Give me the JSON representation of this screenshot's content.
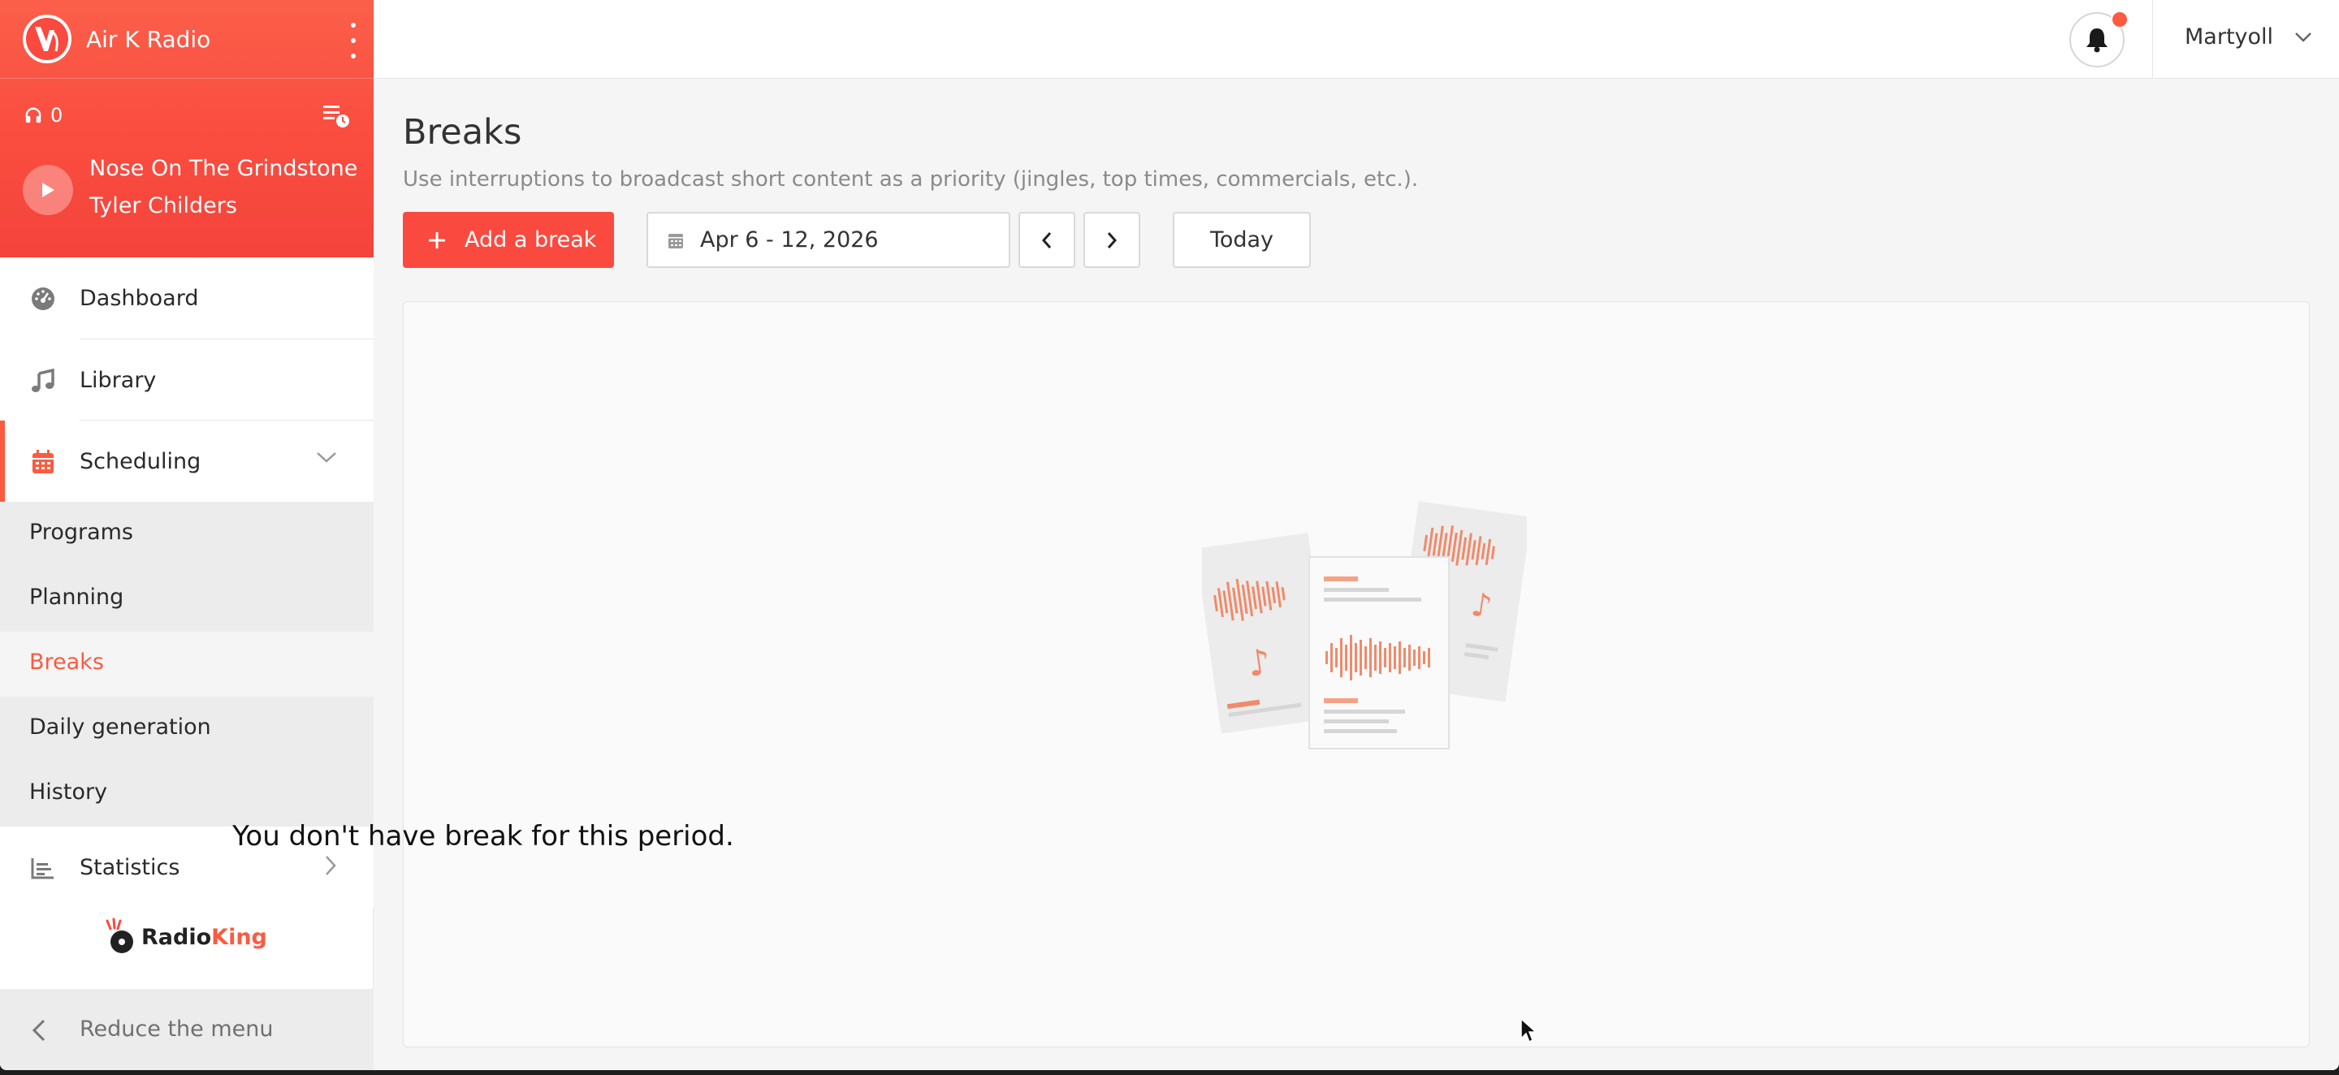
{
  "app": {
    "name": "Air K Radio"
  },
  "player": {
    "listeners": "0",
    "track_title": "Nose On The Grindstone",
    "track_artist": "Tyler Childers"
  },
  "sidebar": {
    "items": [
      {
        "label": "Dashboard",
        "icon": "dashboard-icon"
      },
      {
        "label": "Library",
        "icon": "music-note-icon"
      },
      {
        "label": "Scheduling",
        "icon": "calendar-icon",
        "expanded": true
      },
      {
        "label": "Statistics",
        "icon": "bar-chart-icon"
      }
    ],
    "scheduling_sub": [
      {
        "label": "Programs"
      },
      {
        "label": "Planning"
      },
      {
        "label": "Breaks",
        "active": true
      },
      {
        "label": "Daily generation"
      },
      {
        "label": "History"
      }
    ],
    "brand_logo": {
      "prefix": "Radio",
      "suffix": "King"
    },
    "reduce_label": "Reduce the menu"
  },
  "topbar": {
    "user": "Martyoll",
    "notification_icon": "bell-icon"
  },
  "main": {
    "title": "Breaks",
    "subtitle": "Use interruptions to broadcast short content as a priority (jingles, top times, commercials, etc.).",
    "add_button": "Add a break",
    "date_range": "Apr 6 - 12, 2026",
    "today_button": "Today",
    "empty_message": "You don't have break for this period."
  },
  "colors": {
    "accent": "#fa5b41",
    "header_gradient_top": "#fb5f4a",
    "header_gradient_bottom": "#f4443c"
  }
}
